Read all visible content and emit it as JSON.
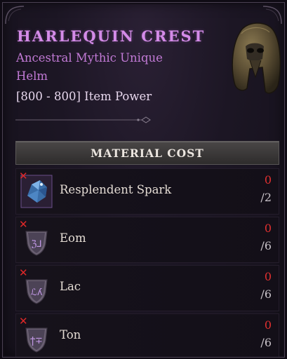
{
  "item": {
    "name": "HARLEQUIN CREST",
    "rarity": "Ancestral Mythic Unique",
    "type": "Helm",
    "item_power": "[800 - 800] Item Power",
    "image_icon": "helm-icon"
  },
  "material_cost": {
    "header": "MATERIAL COST",
    "items": [
      {
        "name": "Resplendent Spark",
        "have": "0",
        "need": "/2",
        "icon": "resplendent-spark-icon",
        "missing_icon": "red-x-icon"
      },
      {
        "name": "Eom",
        "have": "0",
        "need": "/6",
        "icon": "rune-eom-icon",
        "missing_icon": "red-x-icon"
      },
      {
        "name": "Lac",
        "have": "0",
        "need": "/6",
        "icon": "rune-lac-icon",
        "missing_icon": "red-x-icon"
      },
      {
        "name": "Ton",
        "have": "0",
        "need": "/6",
        "icon": "rune-ton-icon",
        "missing_icon": "red-x-icon"
      }
    ]
  },
  "colors": {
    "mythic_purple": "#d48be8",
    "insufficient_red": "#e03030",
    "panel_bg": "#1c1624"
  }
}
